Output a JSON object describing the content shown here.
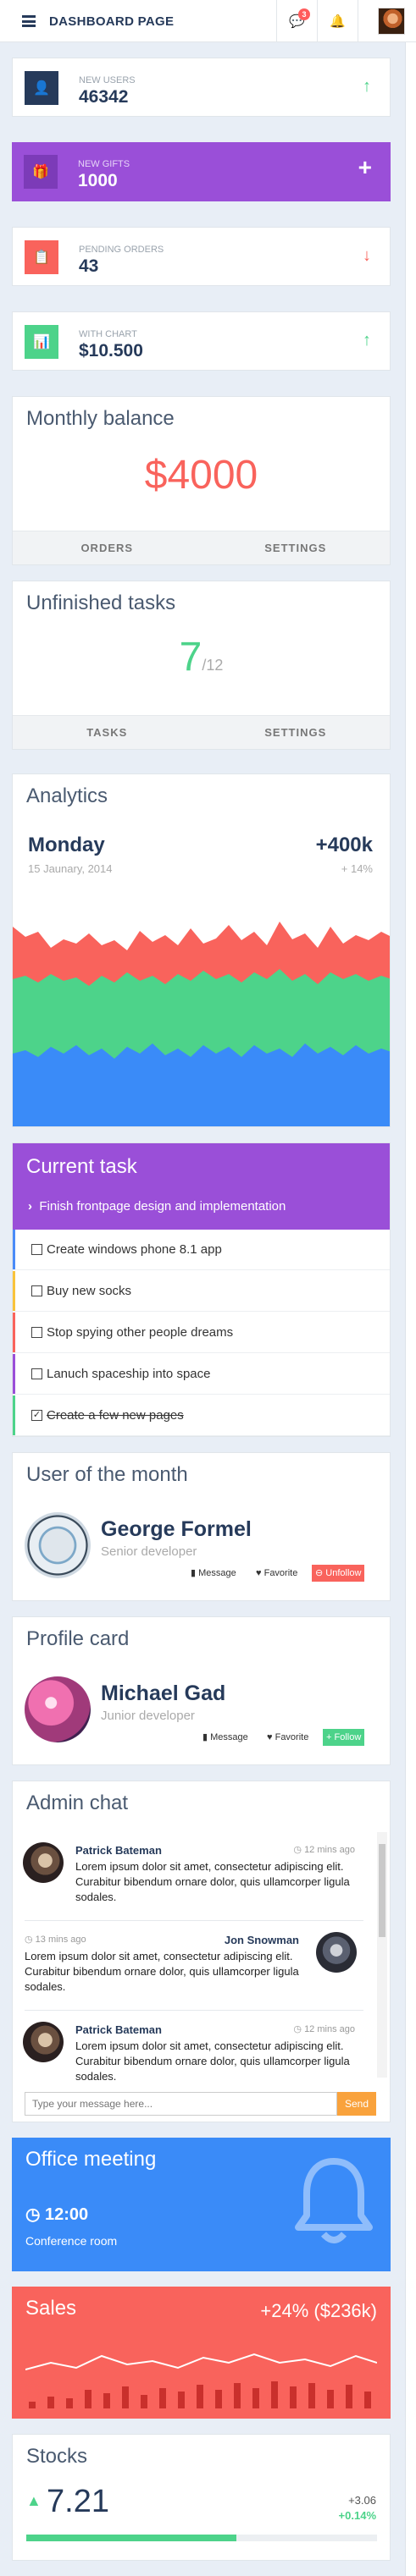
{
  "header": {
    "title": "DASHBOARD PAGE",
    "messages_badge": "3"
  },
  "stats": [
    {
      "label": "NEW USERS",
      "value": "46342",
      "icon": "user-icon",
      "color": "#263a5a",
      "trend": "up-arrow-icon",
      "trend_color": "#4dd38a"
    },
    {
      "label": "NEW GIFTS",
      "value": "1000",
      "icon": "gift-icon",
      "color": "#7c3bb8",
      "trend": "plus-icon",
      "trend_color": "#ffffff"
    },
    {
      "label": "PENDING ORDERS",
      "value": "43",
      "icon": "clipboard-icon",
      "color": "#f9635c",
      "trend": "down-arrow-icon",
      "trend_color": "#f9635c"
    },
    {
      "label": "WITH CHART",
      "value": "$10.500",
      "icon": "bar-chart-icon",
      "color": "#4dd38a",
      "trend": "up-arrow-icon",
      "trend_color": "#4dd38a"
    }
  ],
  "monthly_balance": {
    "title": "Monthly balance",
    "amount": "$4000",
    "btn_orders": "ORDERS",
    "btn_settings": "SETTINGS"
  },
  "unfinished_tasks": {
    "title": "Unfinished tasks",
    "done": "7",
    "total": "/12",
    "btn_tasks": "TASKS",
    "btn_settings": "SETTINGS"
  },
  "analytics": {
    "title": "Analytics",
    "day": "Monday",
    "date": "15 Jaunary, 2014",
    "kpi": "+400k",
    "kpi_change": "+ 14%"
  },
  "current_task": {
    "title": "Current task",
    "current": "Finish frontpage design and implementation",
    "tasks": [
      {
        "label": "Create windows phone 8.1 app",
        "done": false,
        "stripe": "#4a8bf8"
      },
      {
        "label": "Buy new socks",
        "done": false,
        "stripe": "#f9c33c"
      },
      {
        "label": "Stop spying other people dreams",
        "done": false,
        "stripe": "#f9635c"
      },
      {
        "label": "Lanuch spaceship into space",
        "done": false,
        "stripe": "#9a4fd8"
      },
      {
        "label": "Create a few new pages",
        "done": true,
        "stripe": "#4dd38a"
      }
    ]
  },
  "user_of_month": {
    "title": "User of the month",
    "name": "George Formel",
    "role": "Senior developer",
    "btn_message": "Message",
    "btn_favorite": "Favorite",
    "btn_follow": "Unfollow"
  },
  "profile_card": {
    "title": "Profile card",
    "name": "Michael Gad",
    "role": "Junior developer",
    "btn_message": "Message",
    "btn_favorite": "Favorite",
    "btn_follow": "Follow"
  },
  "admin_chat": {
    "title": "Admin chat",
    "messages": [
      {
        "name": "Patrick Bateman",
        "time": "12 mins ago",
        "text": "Lorem ipsum dolor sit amet, consectetur adipiscing elit. Curabitur bibendum ornare dolor, quis ullamcorper ligula sodales.",
        "side": "left"
      },
      {
        "name": "Jon Snowman",
        "time": "13 mins ago",
        "text": "Lorem ipsum dolor sit amet, consectetur adipiscing elit. Curabitur bibendum ornare dolor, quis ullamcorper ligula sodales.",
        "side": "right"
      },
      {
        "name": "Patrick Bateman",
        "time": "12 mins ago",
        "text": "Lorem ipsum dolor sit amet, consectetur adipiscing elit. Curabitur bibendum ornare dolor, quis ullamcorper ligula sodales.",
        "side": "left"
      }
    ],
    "input_placeholder": "Type your message here...",
    "send_label": "Send"
  },
  "office_meeting": {
    "title": "Office meeting",
    "time": "12:00",
    "place": "Conference room"
  },
  "sales": {
    "title": "Sales",
    "change": "+24% ($236k)"
  },
  "stocks": {
    "title": "Stocks",
    "value": "7.21",
    "change_abs": "+3.06",
    "change_pct": "+0.14%",
    "progress": 0.6
  }
}
